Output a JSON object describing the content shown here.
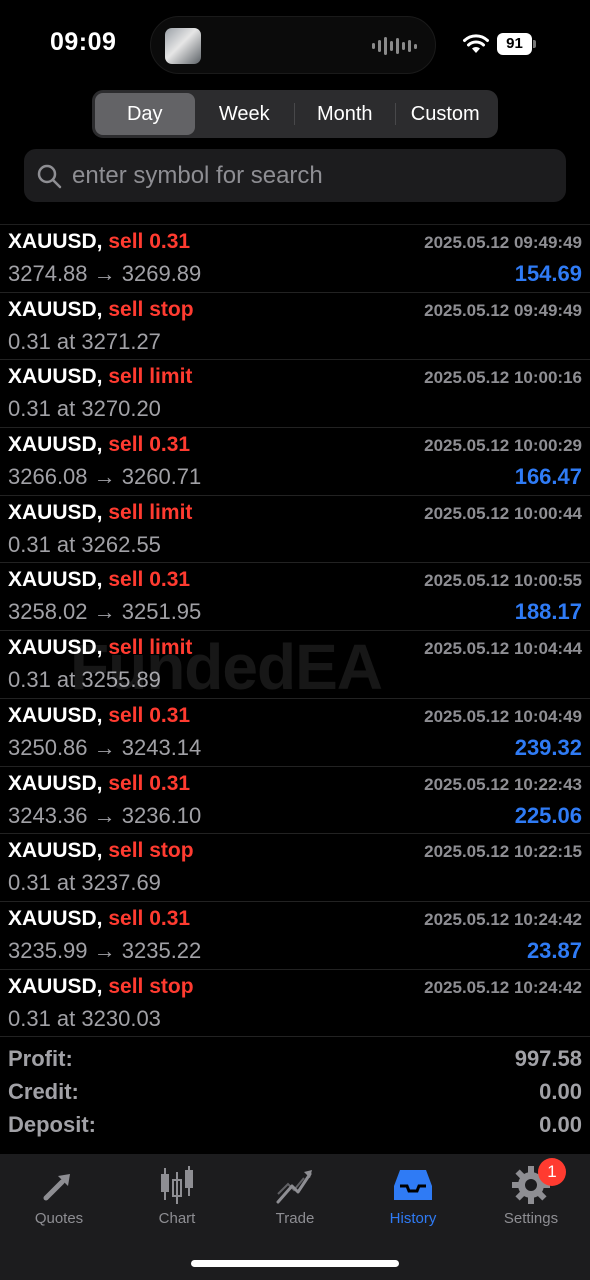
{
  "status": {
    "time": "09:09",
    "battery": "91"
  },
  "segments": [
    "Day",
    "Week",
    "Month",
    "Custom"
  ],
  "search": {
    "placeholder": "enter symbol for search"
  },
  "watermark": "FundedEA",
  "deals": [
    {
      "symbol": "XAUUSD,",
      "action": "sell 0.31",
      "time": "2025.05.12 09:49:49",
      "detail": "3274.88 → 3269.89",
      "profit": "154.69"
    },
    {
      "symbol": "XAUUSD,",
      "action": "sell stop",
      "time": "2025.05.12 09:49:49",
      "detail": "0.31 at 3271.27",
      "profit": ""
    },
    {
      "symbol": "XAUUSD,",
      "action": "sell limit",
      "time": "2025.05.12 10:00:16",
      "detail": "0.31 at 3270.20",
      "profit": ""
    },
    {
      "symbol": "XAUUSD,",
      "action": "sell 0.31",
      "time": "2025.05.12 10:00:29",
      "detail": "3266.08 → 3260.71",
      "profit": "166.47"
    },
    {
      "symbol": "XAUUSD,",
      "action": "sell limit",
      "time": "2025.05.12 10:00:44",
      "detail": "0.31 at 3262.55",
      "profit": ""
    },
    {
      "symbol": "XAUUSD,",
      "action": "sell 0.31",
      "time": "2025.05.12 10:00:55",
      "detail": "3258.02 → 3251.95",
      "profit": "188.17"
    },
    {
      "symbol": "XAUUSD,",
      "action": "sell limit",
      "time": "2025.05.12 10:04:44",
      "detail": "0.31 at 3255.89",
      "profit": ""
    },
    {
      "symbol": "XAUUSD,",
      "action": "sell 0.31",
      "time": "2025.05.12 10:04:49",
      "detail": "3250.86 → 3243.14",
      "profit": "239.32"
    },
    {
      "symbol": "XAUUSD,",
      "action": "sell 0.31",
      "time": "2025.05.12 10:22:43",
      "detail": "3243.36 → 3236.10",
      "profit": "225.06"
    },
    {
      "symbol": "XAUUSD,",
      "action": "sell stop",
      "time": "2025.05.12 10:22:15",
      "detail": "0.31 at 3237.69",
      "profit": ""
    },
    {
      "symbol": "XAUUSD,",
      "action": "sell 0.31",
      "time": "2025.05.12 10:24:42",
      "detail": "3235.99 → 3235.22",
      "profit": "23.87"
    },
    {
      "symbol": "XAUUSD,",
      "action": "sell stop",
      "time": "2025.05.12 10:24:42",
      "detail": "0.31 at 3230.03",
      "profit": ""
    }
  ],
  "summary": [
    {
      "label": "Profit:",
      "value": "997.58"
    },
    {
      "label": "Credit:",
      "value": "0.00"
    },
    {
      "label": "Deposit:",
      "value": "0.00"
    }
  ],
  "tabs": [
    {
      "label": "Quotes",
      "icon": "quotes-icon"
    },
    {
      "label": "Chart",
      "icon": "candlestick-icon"
    },
    {
      "label": "Trade",
      "icon": "trend-icon"
    },
    {
      "label": "History",
      "icon": "inbox-icon"
    },
    {
      "label": "Settings",
      "icon": "gear-icon",
      "badge": "1"
    }
  ],
  "colors": {
    "accent": "#2f7bf5",
    "sell": "#ff3b30",
    "background": "#000000",
    "tabbar": "#1c1c1e"
  }
}
